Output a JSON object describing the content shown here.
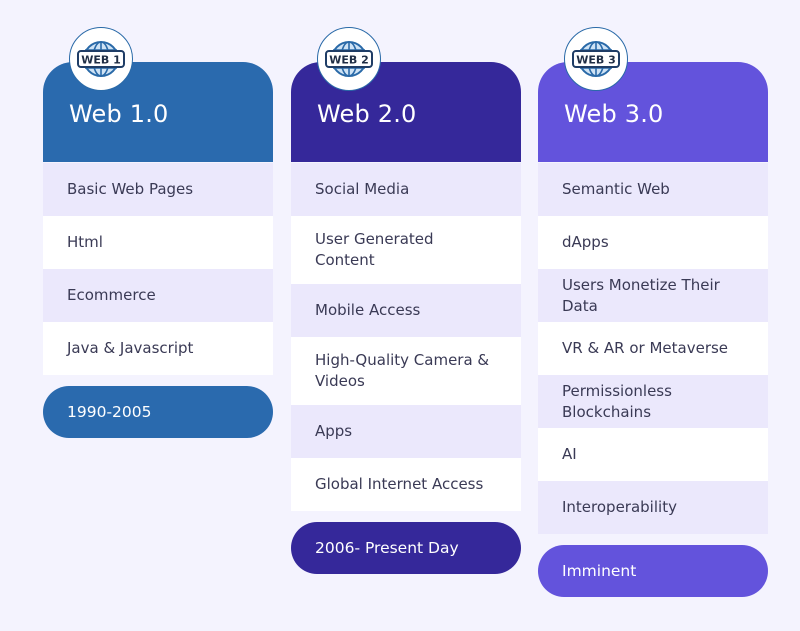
{
  "columns": [
    {
      "badge": "WEB 1",
      "title": "Web 1.0",
      "color": "#2a6aae",
      "items": [
        "Basic Web Pages",
        "Html",
        "Ecommerce",
        "Java & Javascript"
      ],
      "period": "1990-2005"
    },
    {
      "badge": "WEB 2",
      "title": "Web 2.0",
      "color": "#35289a",
      "items": [
        "Social Media",
        "User Generated Content",
        "Mobile Access",
        "High-Quality Camera & Videos",
        "Apps",
        "Global Internet Access"
      ],
      "period": "2006- Present Day"
    },
    {
      "badge": "WEB 3",
      "title": "Web 3.0",
      "color": "#6353dc",
      "items": [
        "Semantic Web",
        "dApps",
        "Users Monetize Their Data",
        "VR & AR or Metaverse",
        "Permissionless Blockchains",
        "AI",
        "Interoperability"
      ],
      "period": "Imminent"
    }
  ],
  "icons": {
    "badge": "globe-web-icon"
  }
}
